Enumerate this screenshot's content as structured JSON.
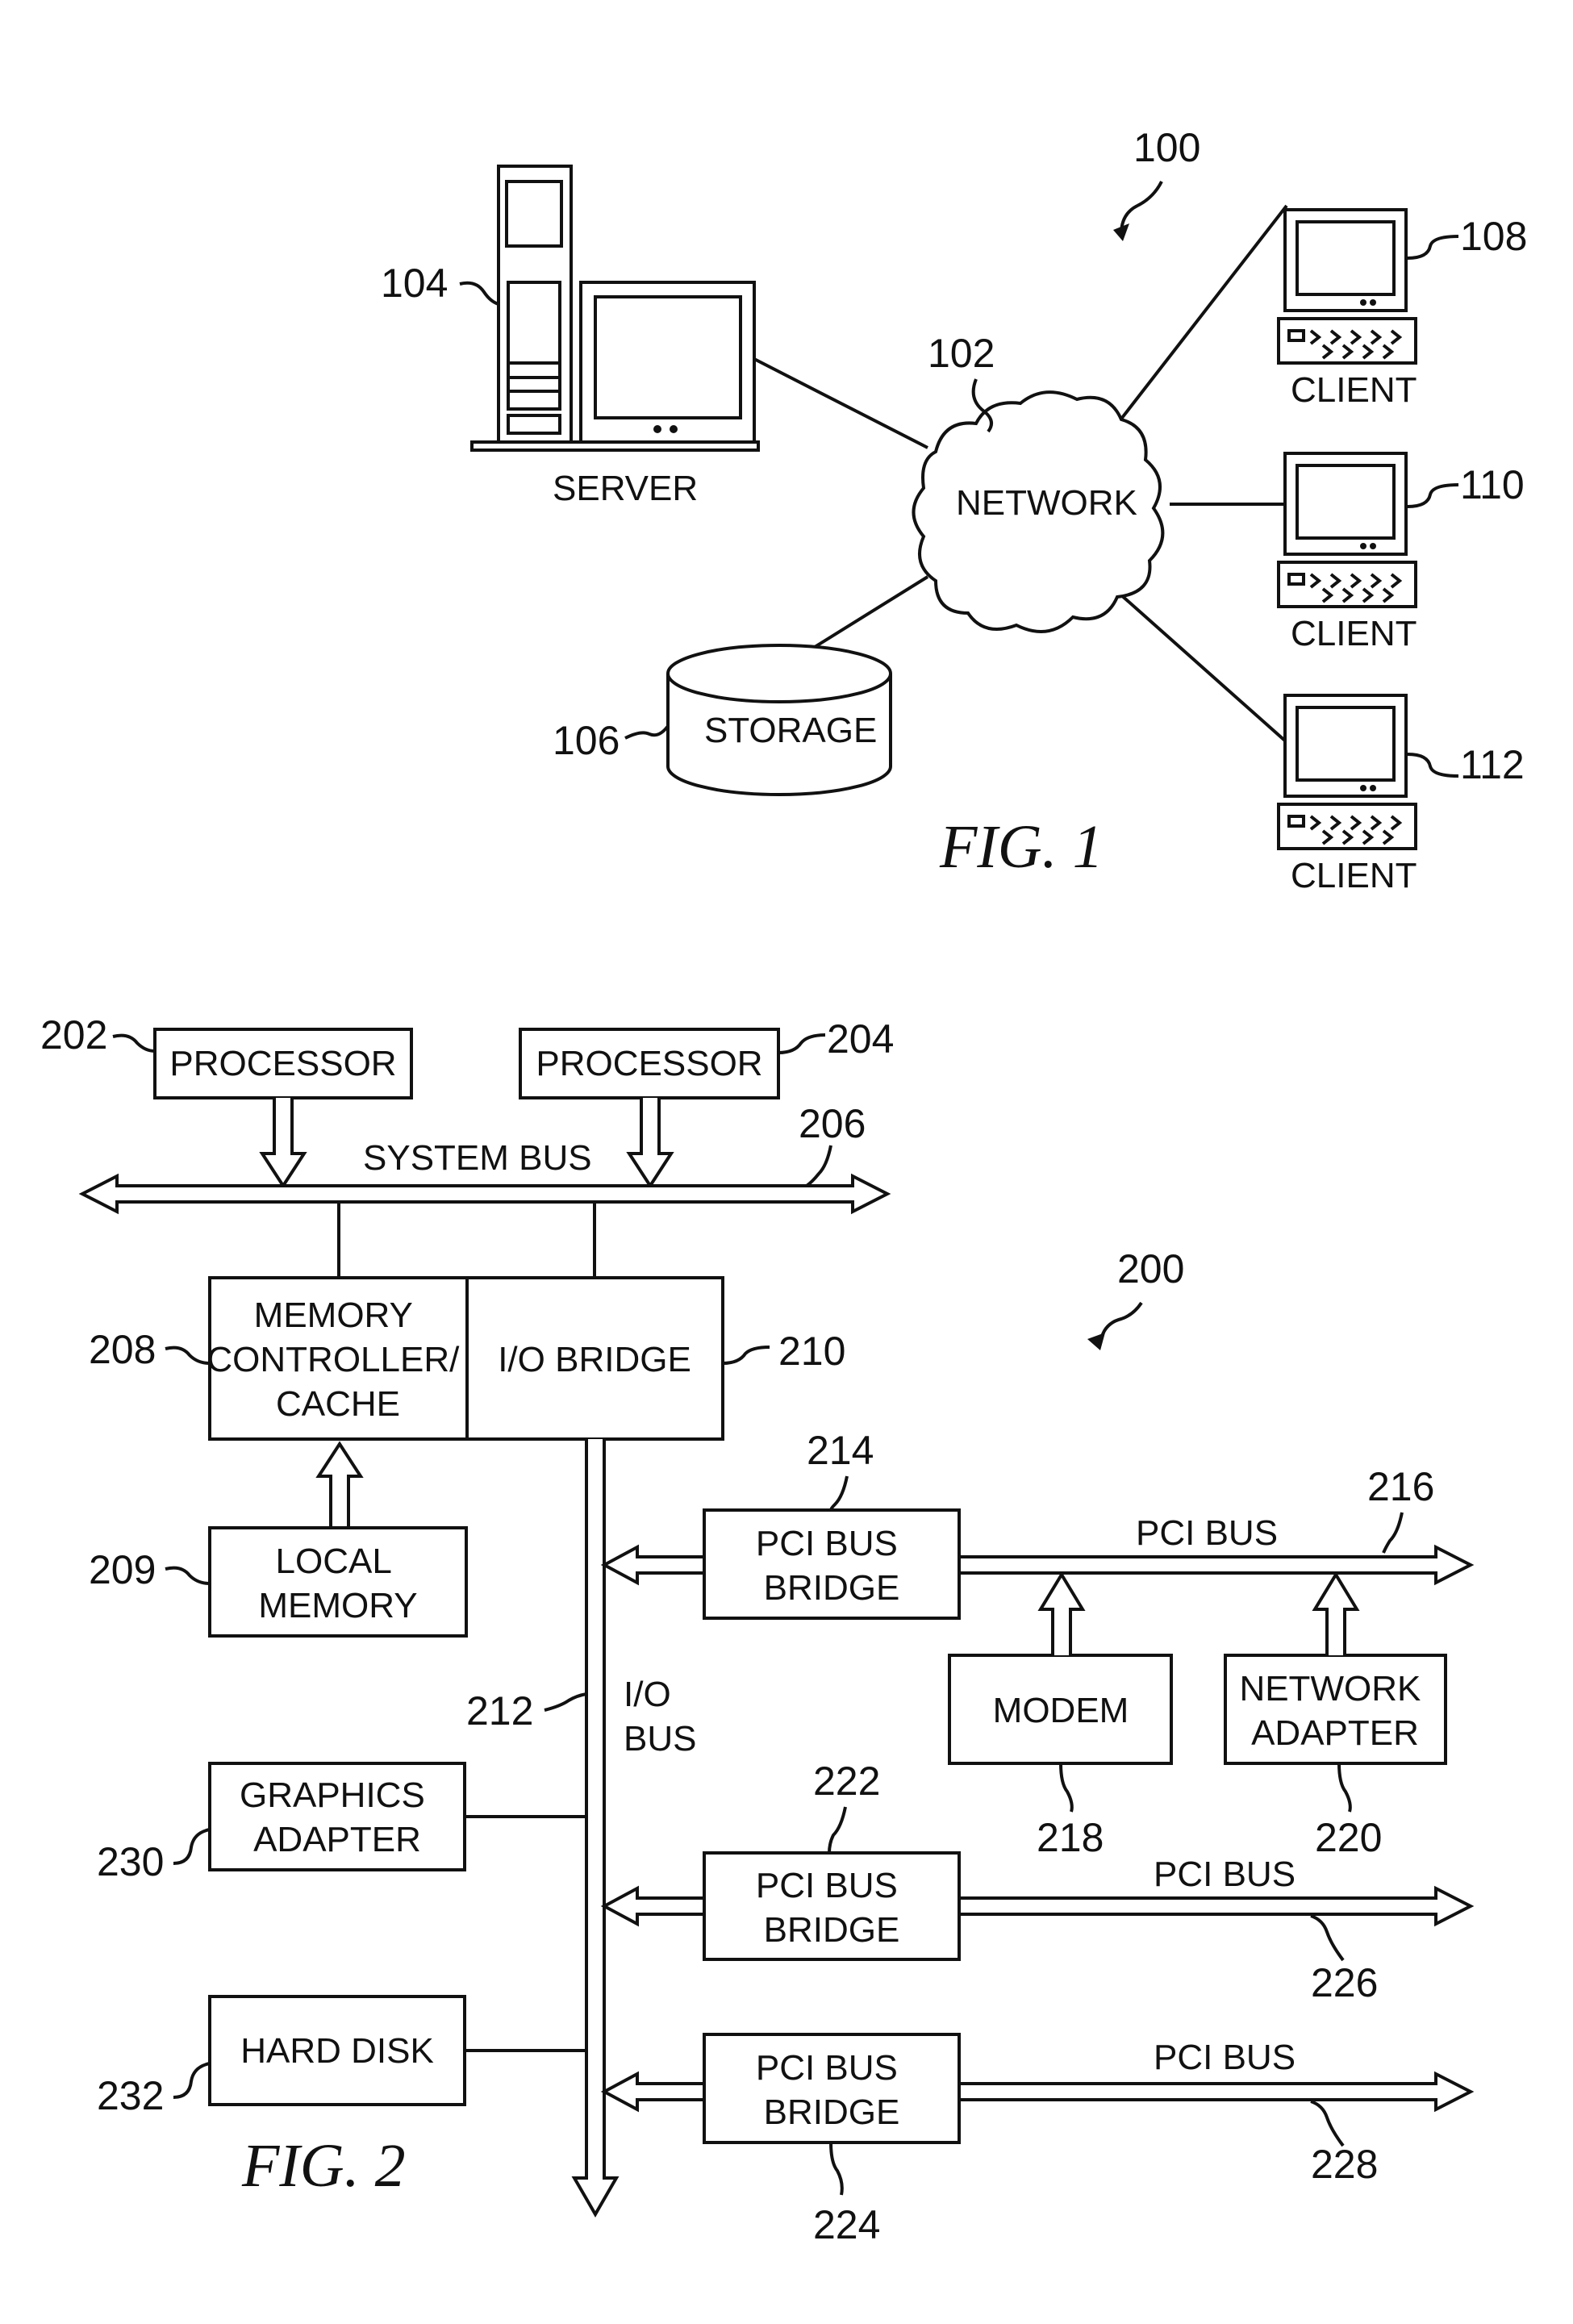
{
  "figure1": {
    "caption": "FIG. 1",
    "system_ref": "100",
    "network": {
      "ref": "102",
      "label": "NETWORK"
    },
    "server": {
      "ref": "104",
      "label": "SERVER"
    },
    "storage": {
      "ref": "106",
      "label": "STORAGE"
    },
    "clients": [
      {
        "ref": "108",
        "label": "CLIENT"
      },
      {
        "ref": "110",
        "label": "CLIENT"
      },
      {
        "ref": "112",
        "label": "CLIENT"
      }
    ]
  },
  "figure2": {
    "caption": "FIG. 2",
    "system_ref": "200",
    "processors": [
      {
        "ref": "202",
        "label": "PROCESSOR"
      },
      {
        "ref": "204",
        "label": "PROCESSOR"
      }
    ],
    "system_bus": {
      "ref": "206",
      "label": "SYSTEM BUS"
    },
    "memory_controller": {
      "ref": "208",
      "lines": [
        "MEMORY",
        "CONTROLLER/",
        "CACHE"
      ]
    },
    "local_memory": {
      "ref": "209",
      "lines": [
        "LOCAL",
        "MEMORY"
      ]
    },
    "io_bridge": {
      "ref": "210",
      "label": "I/O BRIDGE"
    },
    "io_bus": {
      "ref": "212",
      "lines": [
        "I/O",
        "BUS"
      ]
    },
    "pci_bridges": [
      {
        "ref": "214",
        "lines": [
          "PCI BUS",
          "BRIDGE"
        ],
        "bus_ref": "216",
        "bus_label": "PCI BUS"
      },
      {
        "ref": "222",
        "lines": [
          "PCI BUS",
          "BRIDGE"
        ],
        "bus_ref": "226",
        "bus_label": "PCI BUS"
      },
      {
        "ref": "224",
        "lines": [
          "PCI BUS",
          "BRIDGE"
        ],
        "bus_ref": "228",
        "bus_label": "PCI BUS"
      }
    ],
    "modem": {
      "ref": "218",
      "label": "MODEM"
    },
    "network_adapter": {
      "ref": "220",
      "lines": [
        "NETWORK",
        "ADAPTER"
      ]
    },
    "graphics_adapter": {
      "ref": "230",
      "lines": [
        "GRAPHICS",
        "ADAPTER"
      ]
    },
    "hard_disk": {
      "ref": "232",
      "label": "HARD DISK"
    }
  }
}
